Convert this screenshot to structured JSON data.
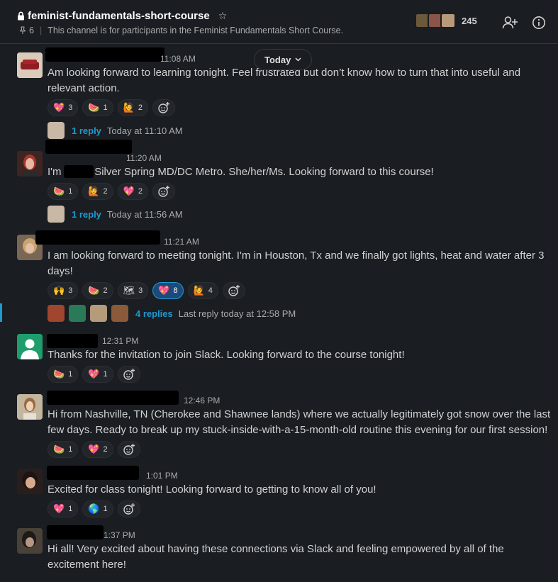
{
  "channel": {
    "name": "feminist-fundamentals-short-course",
    "pins": "6",
    "description": "This channel is for participants in the Feminist Fundamentals Short Course.",
    "member_count": "245"
  },
  "divider": {
    "label": "Today"
  },
  "messages": [
    {
      "time": "11:08 AM",
      "text": "Am looking forward to learning tonight. Feel frustrated but don’t know how to turn that into useful and relevant action.",
      "reactions": [
        {
          "emoji": "💖",
          "count": "3"
        },
        {
          "emoji": "🍉",
          "count": "1"
        },
        {
          "emoji": "🙋",
          "count": "2"
        }
      ],
      "thread": {
        "replies": "1 reply",
        "time": "Today at 11:10 AM"
      }
    },
    {
      "time": "11:20 AM",
      "text": "I'm        , from Silver Spring MD/DC Metro. She/her/Ms. Looking forward to this course!",
      "reactions": [
        {
          "emoji": "🍉",
          "count": "1"
        },
        {
          "emoji": "🙋",
          "count": "2"
        },
        {
          "emoji": "💖",
          "count": "2"
        }
      ],
      "thread": {
        "replies": "1 reply",
        "time": "Today at 11:56 AM"
      }
    },
    {
      "time": "11:21 AM",
      "text": "I am looking forward to meeting tonight. I'm in Houston, Tx and we finally got lights, heat and water after 3 days!",
      "reactions": [
        {
          "emoji": "🙌",
          "count": "3"
        },
        {
          "emoji": "🍉",
          "count": "2"
        },
        {
          "emoji": "🗺",
          "count": "3"
        },
        {
          "emoji": "💖",
          "count": "8"
        },
        {
          "emoji": "🙋",
          "count": "4"
        }
      ],
      "thread": {
        "replies": "4 replies",
        "time": "Last reply today at 12:58 PM"
      }
    },
    {
      "time": "12:31 PM",
      "text": "Thanks for the invitation to join Slack.  Looking forward to the course tonight!",
      "reactions": [
        {
          "emoji": "🍉",
          "count": "1"
        },
        {
          "emoji": "💖",
          "count": "1"
        }
      ]
    },
    {
      "time": "12:46 PM",
      "text": "Hi from Nashville, TN (Cherokee and Shawnee lands) where we actually legitimately got snow over the last few days. Ready to break up my stuck-inside-with-a-15-month-old routine this evening for our first session!",
      "reactions": [
        {
          "emoji": "🍉",
          "count": "1"
        },
        {
          "emoji": "💖",
          "count": "2"
        }
      ]
    },
    {
      "time": "1:01 PM",
      "text": "Excited for class tonight! Looking forward to getting to know all of you!",
      "reactions": [
        {
          "emoji": "💖",
          "count": "1"
        },
        {
          "emoji": "🌎",
          "count": "1"
        }
      ]
    },
    {
      "time": "1:37 PM",
      "text": "Hi all!  Very excited about having these connections via Slack and feeling empowered by all of the excitement here!"
    }
  ],
  "icons": {
    "lock": "lock-icon",
    "star": "star-icon",
    "pin": "pin-icon",
    "add_user": "add-user-icon",
    "info": "info-icon",
    "add_reaction": "add-reaction-icon",
    "chevron": "chevron-down-icon"
  },
  "colors": {
    "background": "#1a1d21",
    "link": "#1d9bd1",
    "text": "#d1d2d3",
    "muted": "#ababad"
  }
}
